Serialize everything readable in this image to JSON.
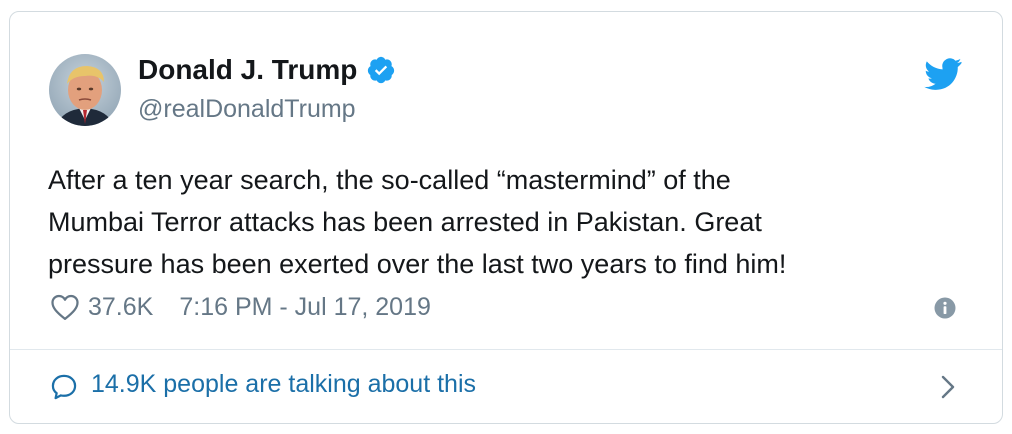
{
  "tweet": {
    "author": {
      "display_name": "Donald J. Trump",
      "handle": "@realDonaldTrump",
      "verified_icon": "verified-badge-icon",
      "avatar_icon": "profile-photo"
    },
    "brand_icon": "twitter-bird-icon",
    "text_lines": [
      "After a ten year search, the so-called “mastermind” of the",
      "Mumbai Terror attacks has been arrested in Pakistan. Great",
      "pressure has been exerted over the last two years to find him!"
    ],
    "likes": "37.6K",
    "like_icon": "heart-icon",
    "timestamp": "7:16 PM - Jul 17, 2019",
    "info_icon": "info-icon",
    "conversation": {
      "label": "14.9K people are talking about this",
      "icon": "speech-bubble-icon",
      "chevron": "chevron-right-icon"
    }
  },
  "colors": {
    "twitter_blue": "#1da1f2",
    "text": "#14171a",
    "muted": "#657786",
    "link": "#1b6fa8",
    "border": "#d3dbe0"
  }
}
